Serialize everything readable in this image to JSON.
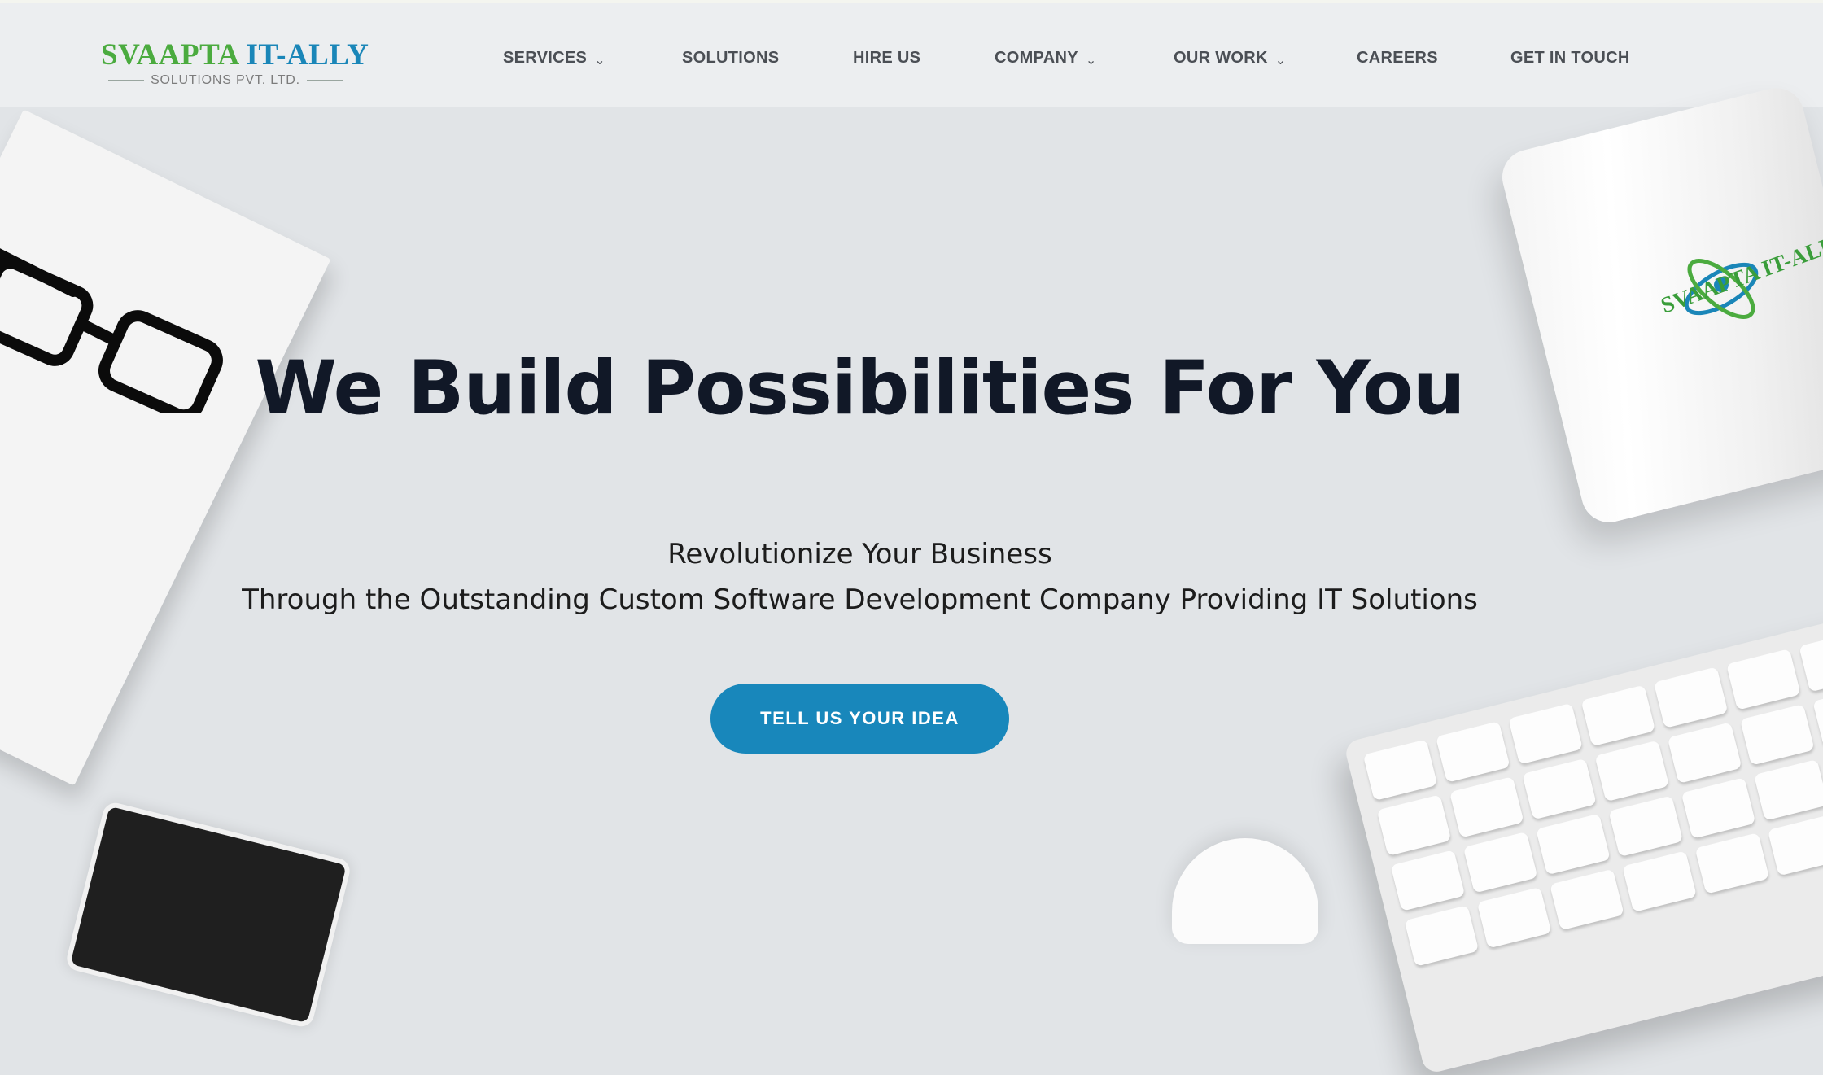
{
  "header": {
    "logo": {
      "brand_part1": "SVAAPTA",
      "brand_part2": "IT-ALLY",
      "tagline": "SOLUTIONS PVT. LTD."
    },
    "nav": [
      {
        "label": "SERVICES",
        "has_dropdown": true
      },
      {
        "label": "SOLUTIONS",
        "has_dropdown": false
      },
      {
        "label": "HIRE US",
        "has_dropdown": false
      },
      {
        "label": "COMPANY",
        "has_dropdown": true
      },
      {
        "label": "OUR WORK",
        "has_dropdown": true
      },
      {
        "label": "CAREERS",
        "has_dropdown": false
      },
      {
        "label": "GET IN TOUCH",
        "has_dropdown": false
      }
    ],
    "dropdown_icon": "chevron-down-icon"
  },
  "hero": {
    "title": "We Build Possibilities For You",
    "subtitle_line1": "Revolutionize Your Business",
    "subtitle_line2": "Through the Outstanding Custom Software Development Company Providing IT Solutions",
    "cta_label": "TELL US YOUR IDEA",
    "mug_logo_text": "SVAAPTA IT-ALLY"
  },
  "colors": {
    "brand_green": "#4bab3f",
    "brand_blue": "#1a86b8",
    "cta_background": "#1887bb",
    "hero_title": "#111827",
    "page_background": "#e1e4e7",
    "header_background": "#eceef0"
  }
}
